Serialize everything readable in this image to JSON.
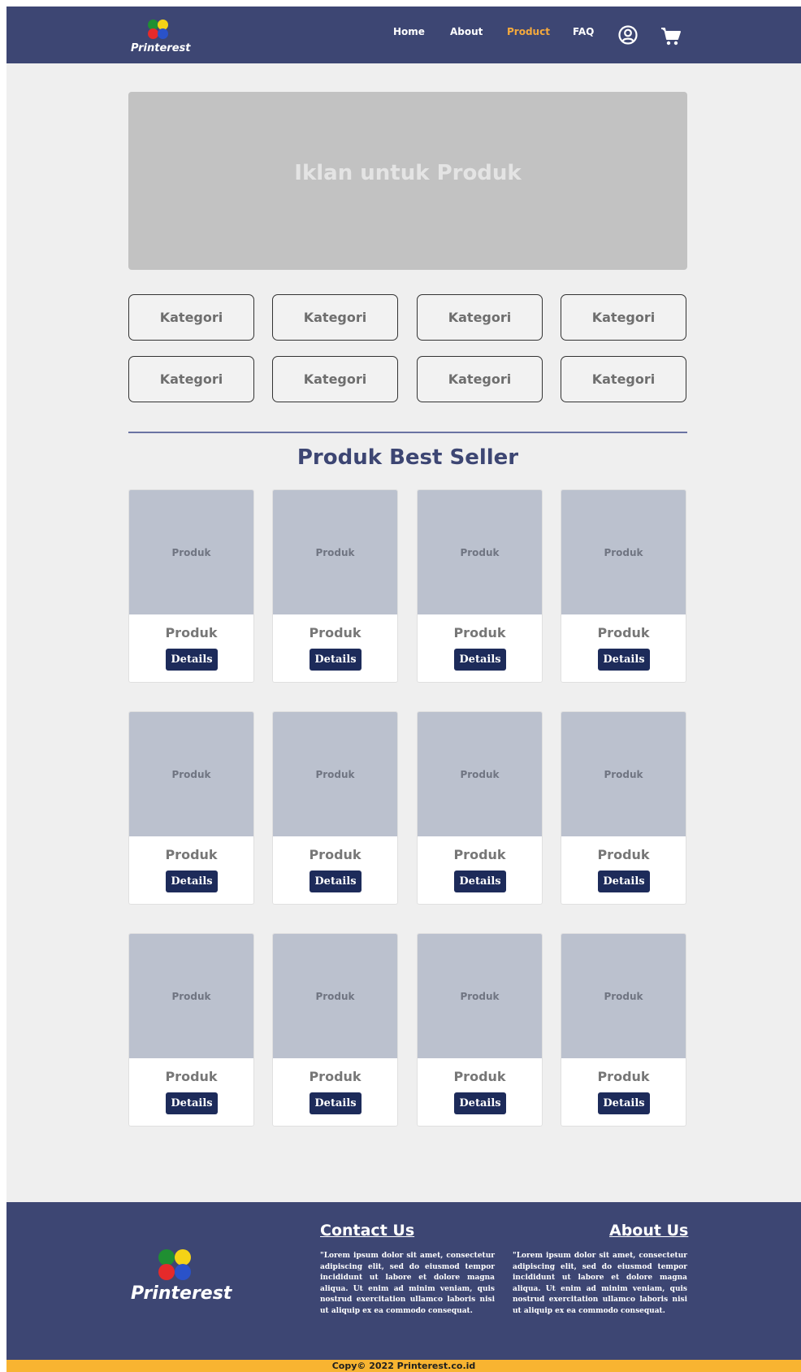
{
  "brand": {
    "name": "Printerest"
  },
  "nav": {
    "links": [
      "Home",
      "About",
      "Product",
      "FAQ"
    ],
    "active": "Product",
    "icons": [
      "user-circle-icon",
      "cart-icon"
    ]
  },
  "banner": {
    "text": "Iklan untuk Produk"
  },
  "categories": [
    "Kategori",
    "Kategori",
    "Kategori",
    "Kategori",
    "Kategori",
    "Kategori",
    "Kategori",
    "Kategori"
  ],
  "best_seller": {
    "title": "Produk Best Seller",
    "products": [
      {
        "image_label": "Produk",
        "name": "Produk",
        "button": "Details"
      },
      {
        "image_label": "Produk",
        "name": "Produk",
        "button": "Details"
      },
      {
        "image_label": "Produk",
        "name": "Produk",
        "button": "Details"
      },
      {
        "image_label": "Produk",
        "name": "Produk",
        "button": "Details"
      },
      {
        "image_label": "Produk",
        "name": "Produk",
        "button": "Details"
      },
      {
        "image_label": "Produk",
        "name": "Produk",
        "button": "Details"
      },
      {
        "image_label": "Produk",
        "name": "Produk",
        "button": "Details"
      },
      {
        "image_label": "Produk",
        "name": "Produk",
        "button": "Details"
      },
      {
        "image_label": "Produk",
        "name": "Produk",
        "button": "Details"
      },
      {
        "image_label": "Produk",
        "name": "Produk",
        "button": "Details"
      },
      {
        "image_label": "Produk",
        "name": "Produk",
        "button": "Details"
      },
      {
        "image_label": "Produk",
        "name": "Produk",
        "button": "Details"
      }
    ]
  },
  "footer": {
    "contact": {
      "title": "Contact Us",
      "text": "\"Lorem ipsum dolor sit amet, consectetur adipiscing elit, sed do eiusmod tempor incididunt ut labore et dolore magna aliqua. Ut enim ad minim veniam, quis nostrud exercitation ullamco laboris nisi ut aliquip ex ea commodo consequat."
    },
    "about": {
      "title": "About Us",
      "text": "\"Lorem ipsum dolor sit amet, consectetur adipiscing elit, sed do eiusmod tempor incididunt ut labore et dolore magna aliqua. Ut enim ad minim veniam, quis nostrud exercitation ullamco laboris nisi ut aliquip ex ea commodo consequat."
    },
    "copyright": "Copy© 2022 Printerest.co.id"
  },
  "colors": {
    "navy": "#3d4673",
    "active_link": "#f5a93c",
    "button": "#1d2b5a",
    "copyright_bar": "#f8b431",
    "logo_dots": [
      "#1f8f32",
      "#f5d316",
      "#e52a2a",
      "#2a52c9"
    ]
  }
}
